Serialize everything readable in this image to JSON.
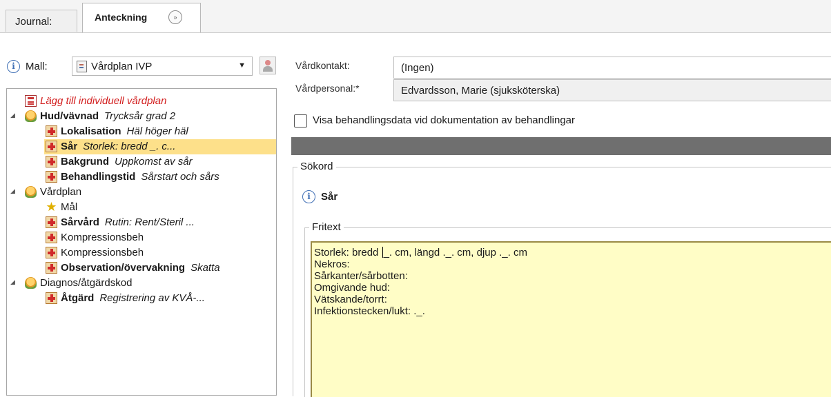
{
  "tabs": [
    {
      "label": "Journal:"
    },
    {
      "label": "Anteckning",
      "expander_icon": "double-chevron-right-icon"
    }
  ],
  "left": {
    "mall_label": "Mall:",
    "mall_value": "Vårdplan IVP",
    "tree": {
      "add_plan": "Lägg till individuell vårdplan",
      "groups": [
        {
          "name": "Hud/vävnad",
          "subtitle": "Trycksår grad 2",
          "items": [
            {
              "name": "Lokalisation",
              "subtitle": "Häl höger häl"
            },
            {
              "name": "Sår",
              "subtitle": "Storlek: bredd _. c..."
            },
            {
              "name": "Bakgrund",
              "subtitle": "Uppkomst av sår"
            },
            {
              "name": "Behandlingstid",
              "subtitle": "Sårstart och sårs"
            }
          ]
        },
        {
          "name": "Vårdplan",
          "subtitle": "",
          "items": [
            {
              "name": "Mål",
              "subtitle": ""
            },
            {
              "name": "Sårvård",
              "subtitle": "Rutin: Rent/Steril ..."
            },
            {
              "name": "Kompressionsbeh",
              "subtitle": ""
            },
            {
              "name": "Kompressionsbeh",
              "subtitle": ""
            },
            {
              "name": "Observation/övervakning",
              "subtitle": "Skatta"
            }
          ]
        },
        {
          "name": "Diagnos/åtgärdskod",
          "subtitle": "",
          "items": [
            {
              "name": "Åtgärd",
              "subtitle": "Registrering av KVÅ-..."
            }
          ]
        }
      ]
    }
  },
  "right": {
    "vardkontakt_label": "Vårdkontakt:",
    "vardkontakt_value": "(Ingen)",
    "vardpersonal_label": "Vårdpersonal:*",
    "vardpersonal_value": "Edvardsson, Marie (sjuksköterska)",
    "checkbox_label": "Visa behandlingsdata vid dokumentation av behandlingar",
    "sokord_legend": "Sökord",
    "keyword_title": "Sår",
    "fritext_legend": "Fritext",
    "fritext_line1_a": "Storlek: bredd",
    "fritext_line1_b": "_. cm, längd ._. cm, djup ._. cm",
    "fritext_lines": [
      "Nekros:",
      "Sårkanter/sårbotten:",
      "Omgivande hud:",
      "Vätskande/torrt:",
      "Infektionstecken/lukt: ._."
    ]
  }
}
